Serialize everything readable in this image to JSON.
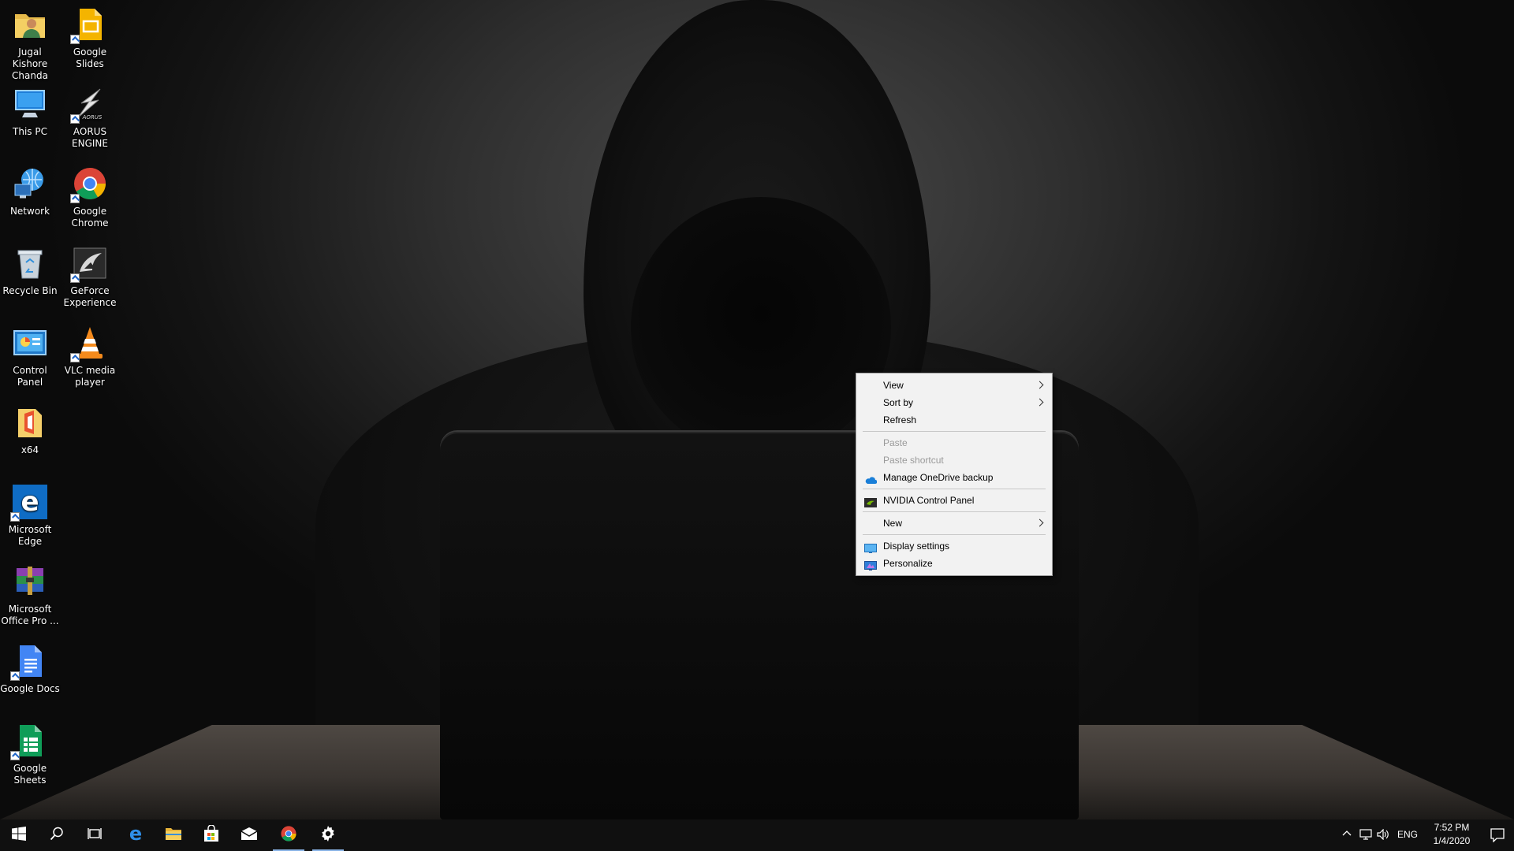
{
  "desktop": {
    "icons": [
      {
        "label": "Jugal Kishore Chanda",
        "icon": "user-folder-icon"
      },
      {
        "label": "Google Slides",
        "icon": "google-slides-icon"
      },
      {
        "label": "This PC",
        "icon": "this-pc-icon"
      },
      {
        "label": "AORUS ENGINE",
        "icon": "aorus-engine-icon"
      },
      {
        "label": "Network",
        "icon": "network-icon"
      },
      {
        "label": "Google Chrome",
        "icon": "chrome-icon"
      },
      {
        "label": "Recycle Bin",
        "icon": "recycle-bin-icon"
      },
      {
        "label": "GeForce Experience",
        "icon": "geforce-experience-icon"
      },
      {
        "label": "Control Panel",
        "icon": "control-panel-icon"
      },
      {
        "label": "VLC media player",
        "icon": "vlc-icon"
      },
      {
        "label": "x64",
        "icon": "office-installer-icon"
      },
      {
        "label": "Microsoft Edge",
        "icon": "edge-icon"
      },
      {
        "label": "Microsoft Office Pro ...",
        "icon": "winrar-archive-icon"
      },
      {
        "label": "Google Docs",
        "icon": "google-docs-icon"
      },
      {
        "label": "Google Sheets",
        "icon": "google-sheets-icon"
      }
    ]
  },
  "context_menu": {
    "view": "View",
    "sort_by": "Sort by",
    "refresh": "Refresh",
    "paste": "Paste",
    "paste_shortcut": "Paste shortcut",
    "onedrive": "Manage OneDrive backup",
    "nvidia": "NVIDIA Control Panel",
    "new": "New",
    "display_settings": "Display settings",
    "personalize": "Personalize"
  },
  "taskbar": {
    "apps": [
      "start-icon",
      "search-icon",
      "task-view-icon",
      "edge-icon",
      "file-explorer-icon",
      "store-icon",
      "mail-icon",
      "chrome-icon",
      "settings-icon"
    ],
    "language": "ENG",
    "time": "7:52 PM",
    "date": "1/4/2020"
  },
  "colors": {
    "menu_bg": "#f2f2f2",
    "taskbar_bg": "#101010",
    "accent": "#8ab4e6"
  }
}
